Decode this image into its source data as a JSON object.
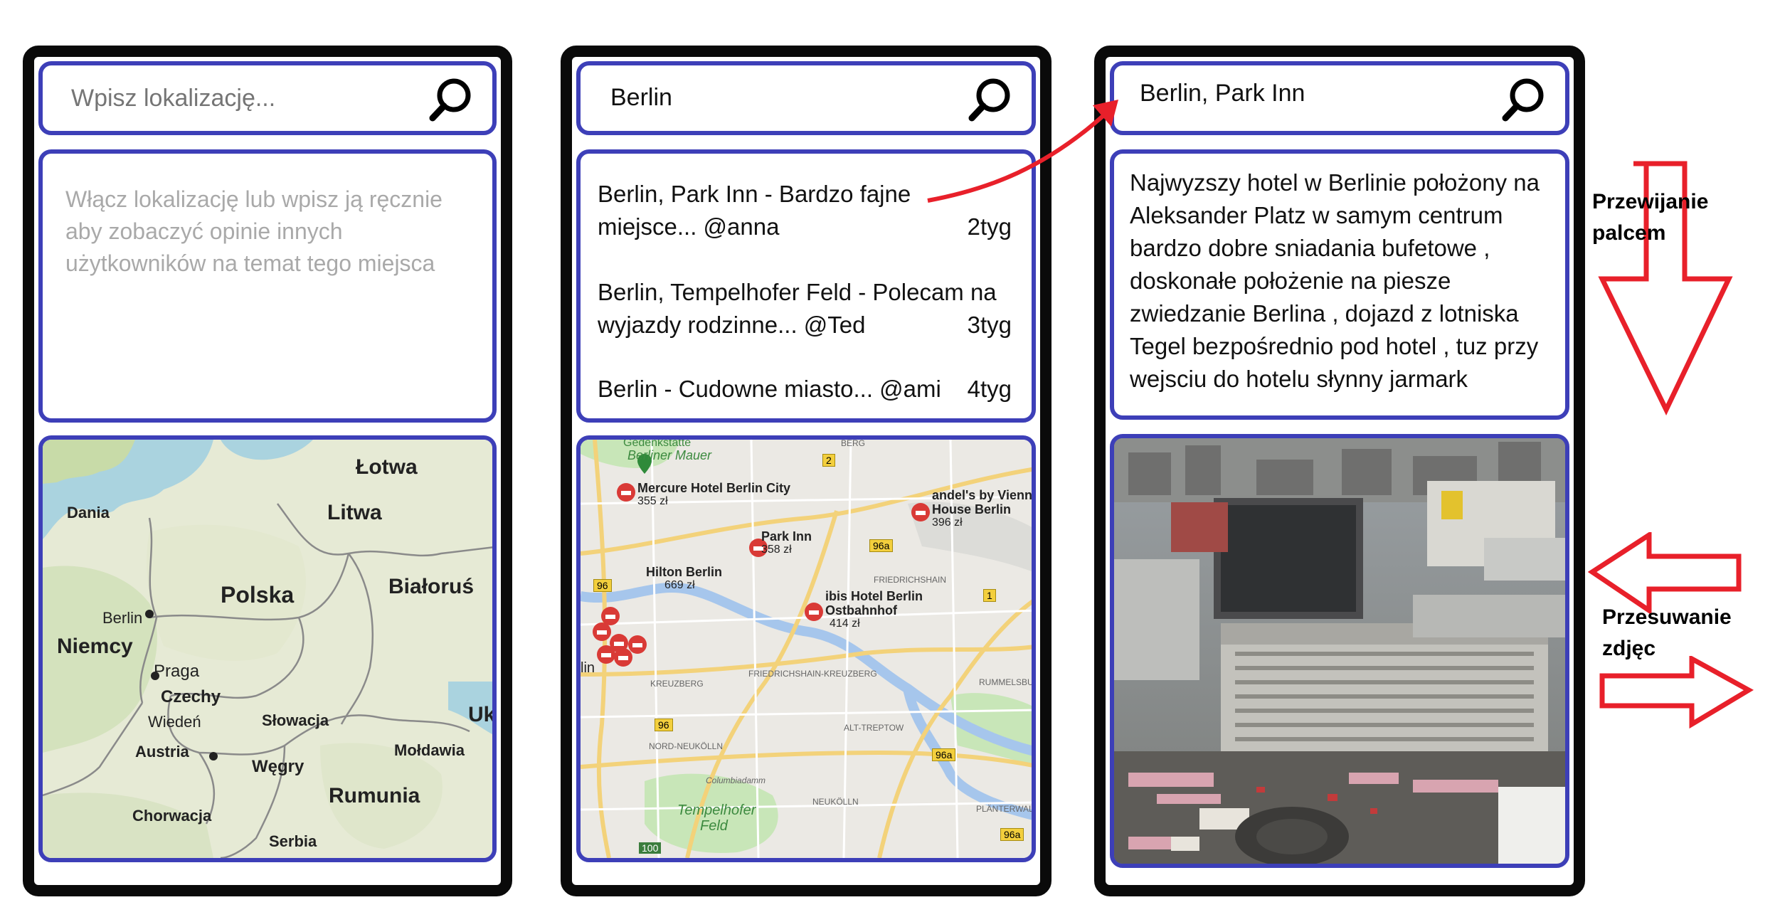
{
  "screens": [
    {
      "search": {
        "placeholder": "Wpisz lokalizację...",
        "value": ""
      },
      "hint": "Włącz lokalizację lub wpisz ją ręcznie aby zobaczyć opinie innych użytkowników na temat tego miejsca",
      "map_labels": {
        "latvia": "Łotwa",
        "lithuania": "Litwa",
        "denmark": "Dania",
        "poland": "Polska",
        "belarus": "Białoruś",
        "berlin": "Berlin",
        "germany": "Niemcy",
        "prague": "Praga",
        "czechia": "Czechy",
        "vienna": "Wiedeń",
        "austria": "Austria",
        "slovakia": "Słowacja",
        "ukraine": "Ukr",
        "hungary": "Węgry",
        "moldova": "Mołdawia",
        "romania": "Rumunia",
        "croatia": "Chorwacja",
        "serbia": "Serbia"
      }
    },
    {
      "search": {
        "value": "Berlin"
      },
      "reviews": [
        {
          "line1": "Berlin, Park Inn - Bardzo fajne",
          "line2": "miejsce... @anna",
          "age": "2tyg"
        },
        {
          "line1": "Berlin, Tempelhofer Feld - Polecam na",
          "line2": "wyjazdy rodzinne... @Ted",
          "age": "3tyg"
        },
        {
          "line1": "Berlin - Cudowne miasto... @ami",
          "line2": "",
          "age": "4tyg"
        }
      ],
      "map_labels": {
        "gedenkstatte": "Gedenkstätte",
        "berliner_mauer": "Berliner Mauer",
        "berg": "BERG",
        "mercure": "Mercure Hotel Berlin City",
        "mercure_price": "355 zł",
        "andels": "andel's by Vienna",
        "andels2": "House Berlin",
        "andels_price": "396 zł",
        "park_inn": "Park Inn",
        "park_inn_price": "358 zł",
        "hilton": "Hilton Berlin",
        "hilton_price": "669 zł",
        "friedrichshain": "FRIEDRICHSHAIN",
        "ibis": "ibis Hotel Berlin",
        "ibis2": "Ostbahnhof",
        "ibis_price": "414 zł",
        "lin": "lin",
        "kreuzberg": "KREUZBERG",
        "fk": "FRIEDRICHSHAIN-KREUZBERG",
        "rummelsburg": "RUMMELSBURG",
        "alt_treptow": "ALT-TREPTOW",
        "neukolln_n": "NORD-NEUKÖLLN",
        "columbia": "Columbiadamm",
        "tempelhofer": "Tempelhofer",
        "feld": "Feld",
        "neukolln": "NEUKÖLLN",
        "planterwald": "PLÄNTERWALD",
        "r2": "2",
        "r96": "96",
        "r96a": "96a",
        "r1": "1",
        "r100": "100"
      }
    },
    {
      "search": {
        "value": "Berlin, Park Inn"
      },
      "description": "Najwyzszy hotel w Berlinie położony na Aleksander Platz w samym centrum bardzo dobre sniadania bufetowe , doskonałe położenie na piesze zwiedzanie Berlina , dojazd z lotniska Tegel bezpośrednio pod hotel , tuz przy wejsciu do hotelu słynny jarmark"
    }
  ],
  "annotations": {
    "scroll_line1": "Przewijanie",
    "scroll_line2": "palcem",
    "swipe_line1": "Przesuwanie",
    "swipe_line2": "zdjęc"
  },
  "colors": {
    "frame": "#0a0a0a",
    "box_border": "#3d3fb8",
    "annotation": "#e8202a",
    "hint": "#a9a9a9"
  },
  "icons": [
    "magnifier-icon",
    "hotel-marker-icon",
    "pin-icon",
    "arrow-down-icon",
    "arrow-left-icon",
    "arrow-right-icon"
  ]
}
